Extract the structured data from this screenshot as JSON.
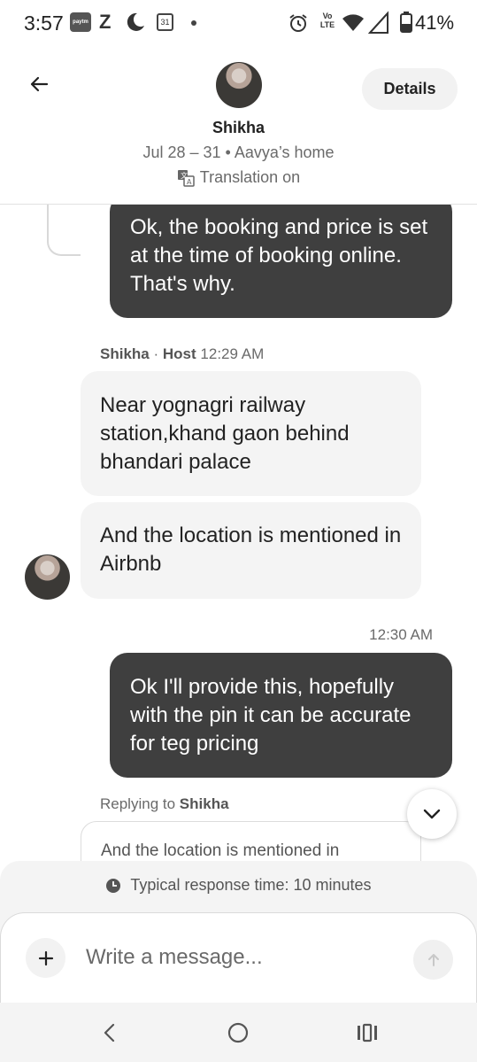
{
  "status_bar": {
    "time": "3:57",
    "battery": "41%",
    "notif_icons": [
      "paytm-icon",
      "z-icon",
      "moon-icon",
      "calendar-icon",
      "dot-icon"
    ],
    "calendar_day": "31",
    "volte_label": "Vo LTE",
    "system_icons": [
      "alarm-icon",
      "volte-icon",
      "wifi-icon",
      "signal-icon",
      "battery-icon"
    ]
  },
  "header": {
    "name": "Shikha",
    "trip": "Jul 28 – 31 • Aavya’s home",
    "translation": "Translation on",
    "details_label": "Details"
  },
  "messages": [
    {
      "direction": "outgoing",
      "text": "Ok, the booking and price is set at the time of booking online. That's why."
    },
    {
      "direction": "incoming",
      "sender": "Shikha",
      "role": "Host",
      "time": "12:29 AM",
      "text": "Near yognagri railway station,khand gaon behind bhandari palace"
    },
    {
      "direction": "incoming",
      "text": "And the location is mentioned in Airbnb"
    },
    {
      "direction": "outgoing",
      "time": "12:30 AM",
      "text": "Ok I'll provide this, hopefully with the pin it can be accurate for teg pricing"
    }
  ],
  "reply": {
    "prefix": "Replying to",
    "name": "Shikha",
    "preview": "And the location is mentioned in"
  },
  "composer": {
    "response_time": "Typical response time: 10 minutes",
    "placeholder": "Write a message..."
  },
  "nav": [
    "back-nav-icon",
    "home-nav-icon",
    "recents-nav-icon"
  ]
}
